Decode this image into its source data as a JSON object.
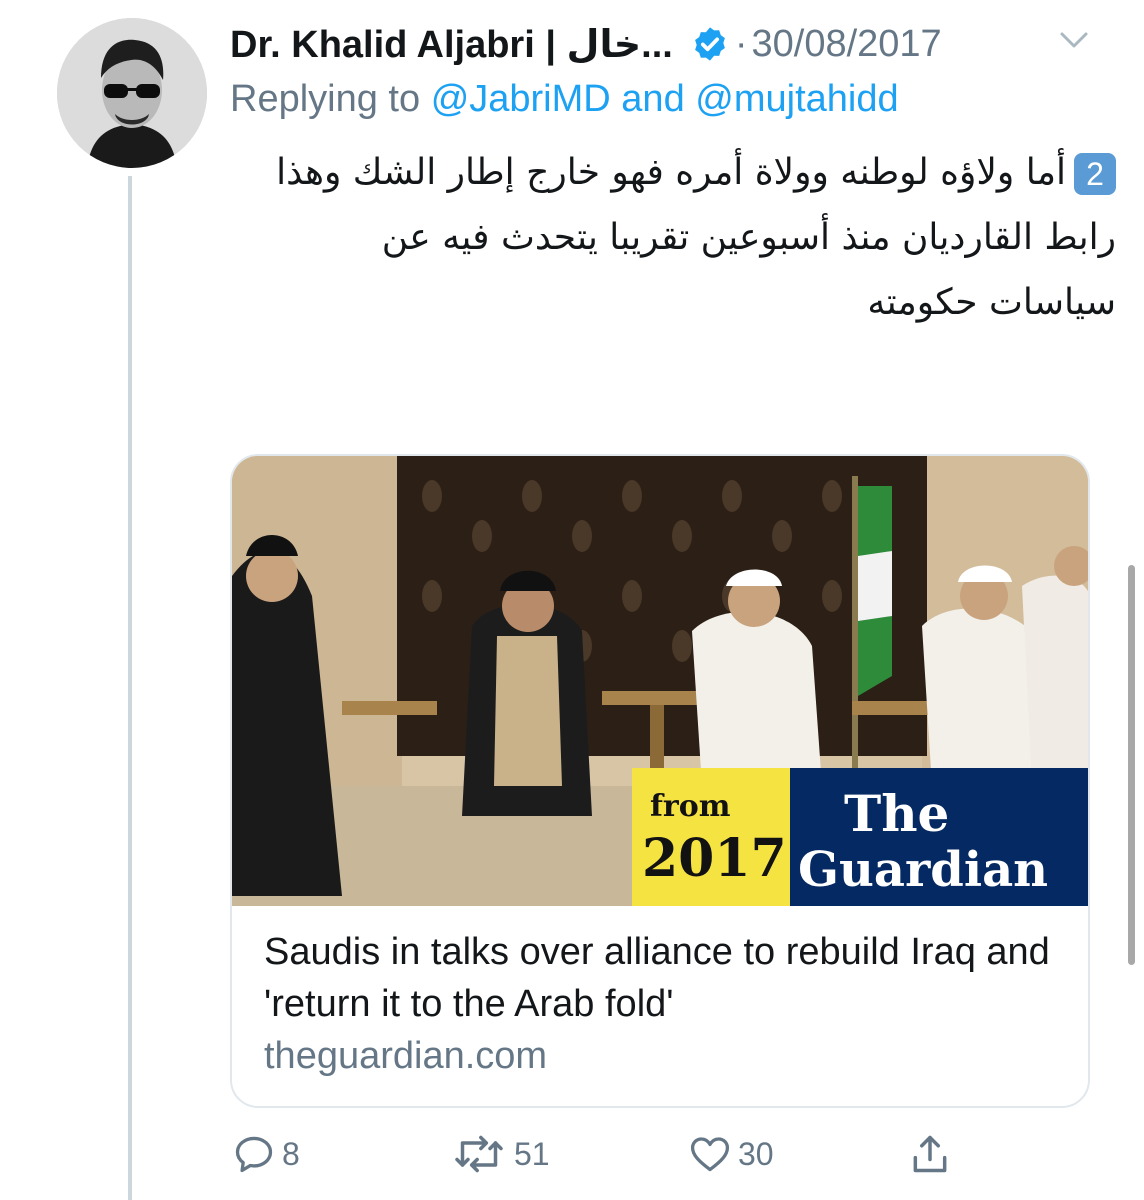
{
  "tweet": {
    "author_name": "Dr. Khalid Aljabri | خال...",
    "separator": "·",
    "date": "30/08/2017",
    "replying_label": "Replying to",
    "mention_1": "@JabriMD",
    "and_label": "and",
    "mention_2": "@mujtahidd",
    "number_badge": "2",
    "text": "أما ولاؤه لوطنه وولاة أمره فهو خارج إطار الشك وهذا رابط القارديان منذ أسبوعين تقريبا يتحدث فيه عن سياسات حكومته"
  },
  "card": {
    "badge_from": "from",
    "badge_year": "2017",
    "logo_the": "The",
    "logo_guardian": "Guardian",
    "title": "Saudis in talks over alliance to rebuild Iraq and 'return it to the Arab fold'",
    "domain": "theguardian.com"
  },
  "actions": {
    "replies": "8",
    "retweets": "51",
    "likes": "30"
  },
  "colors": {
    "accent": "#1da1f2",
    "muted": "#657786",
    "guardian_blue": "#052962",
    "badge_yellow": "#f5e342"
  }
}
